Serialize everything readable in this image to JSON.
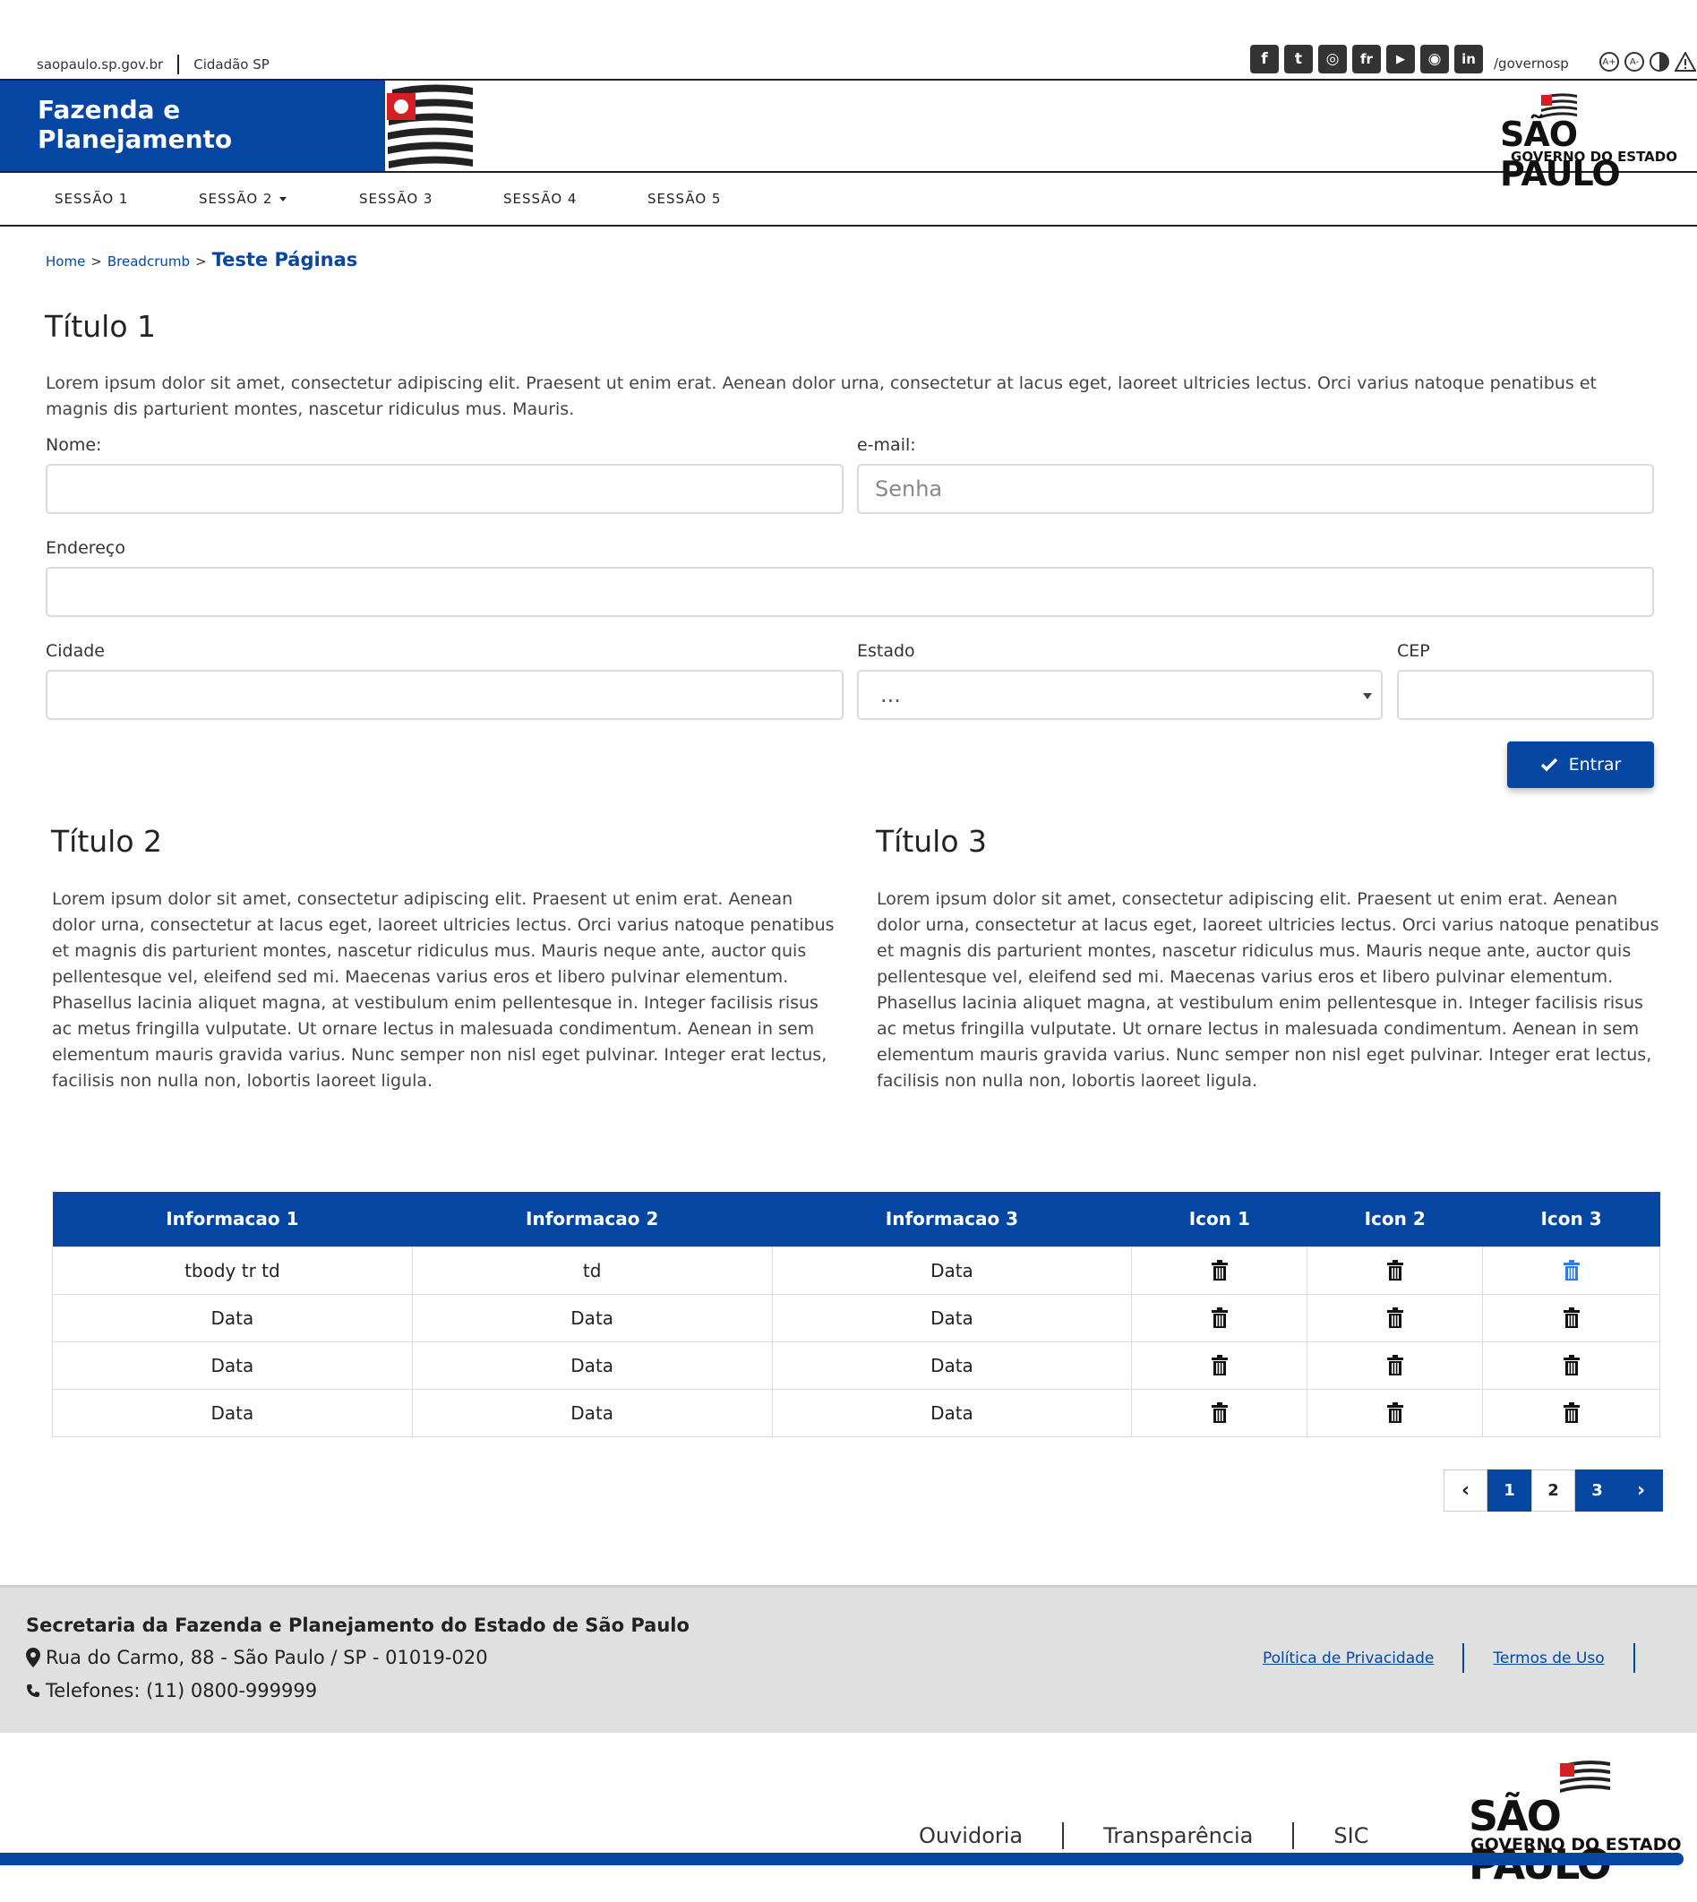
{
  "top": {
    "site_link": "saopaulo.sp.gov.br",
    "cidadao_link": "Cidadão SP",
    "social": [
      {
        "icon": "facebook-icon",
        "glyph": "f"
      },
      {
        "icon": "twitter-icon",
        "glyph": "t"
      },
      {
        "icon": "instagram-icon",
        "glyph": "◎"
      },
      {
        "icon": "flickr-icon",
        "glyph": "fr"
      },
      {
        "icon": "youtube-icon",
        "glyph": "▶"
      },
      {
        "icon": "periscope-icon",
        "glyph": "◉"
      },
      {
        "icon": "linkedin-icon",
        "glyph": "in"
      }
    ],
    "handle": "/governosp"
  },
  "header": {
    "brand_line1": "Fazenda e",
    "brand_line2": "Planejamento",
    "logo_big": "SÃO PAULO",
    "logo_small": "GOVERNO DO ESTADO"
  },
  "nav": {
    "items": [
      "SESSÃO 1",
      "SESSÃO 2",
      "SESSÃO 3",
      "SESSÃO 4",
      "SESSÃO 5"
    ]
  },
  "breadcrumb": {
    "home": "Home",
    "mid": "Breadcrumb",
    "current": "Teste Páginas"
  },
  "section1": {
    "title": "Título 1",
    "text": "Lorem ipsum dolor sit amet, consectetur adipiscing elit. Praesent ut enim erat. Aenean dolor urna, consectetur at lacus eget, laoreet ultricies lectus. Orci varius natoque penatibus et magnis dis parturient montes, nascetur ridiculus mus. Mauris."
  },
  "form": {
    "nome_label": "Nome:",
    "nome_value": "",
    "email_label": "e-mail:",
    "email_placeholder": "Senha",
    "endereco_label": "Endereço",
    "cidade_label": "Cidade",
    "estado_label": "Estado",
    "estado_selected": "...",
    "cep_label": "CEP",
    "submit_label": "Entrar"
  },
  "section2": {
    "title": "Título 2",
    "text": "Lorem ipsum dolor sit amet, consectetur adipiscing elit. Praesent ut enim erat. Aenean dolor urna, consectetur at lacus eget, laoreet ultricies lectus. Orci varius natoque penatibus et magnis dis parturient montes, nascetur ridiculus mus. Mauris neque ante, auctor quis pellentesque vel, eleifend sed mi. Maecenas varius eros et libero pulvinar elementum. Phasellus lacinia aliquet magna, at vestibulum enim pellentesque in. Integer facilisis risus ac metus fringilla vulputate. Ut ornare lectus in malesuada condimentum. Aenean in sem elementum mauris gravida varius. Nunc semper non nisl eget pulvinar. Integer erat lectus, facilisis non nulla non, lobortis laoreet ligula."
  },
  "section3": {
    "title": "Título 3",
    "text": "Lorem ipsum dolor sit amet, consectetur adipiscing elit. Praesent ut enim erat. Aenean dolor urna, consectetur at lacus eget, laoreet ultricies lectus. Orci varius natoque penatibus et magnis dis parturient montes, nascetur ridiculus mus. Mauris neque ante, auctor quis pellentesque vel, eleifend sed mi. Maecenas varius eros et libero pulvinar elementum. Phasellus lacinia aliquet magna, at vestibulum enim pellentesque in. Integer facilisis risus ac metus fringilla vulputate. Ut ornare lectus in malesuada condimentum. Aenean in sem elementum mauris gravida varius. Nunc semper non nisl eget pulvinar. Integer erat lectus, facilisis non nulla non, lobortis laoreet ligula."
  },
  "table": {
    "headers": [
      "Informacao 1",
      "Informacao 2",
      "Informacao 3",
      "Icon 1",
      "Icon 2",
      "Icon 3"
    ],
    "rows": [
      [
        "tbody tr td",
        "td",
        "Data"
      ],
      [
        "Data",
        "Data",
        "Data"
      ],
      [
        "Data",
        "Data",
        "Data"
      ],
      [
        "Data",
        "Data",
        "Data"
      ]
    ],
    "icon": "trash-icon",
    "highlight_color": "#2f7de1"
  },
  "pagination": {
    "prev": "‹",
    "pages": [
      "1",
      "2",
      "3"
    ],
    "next": "›",
    "current": "2"
  },
  "footer": {
    "org": "Secretaria da Fazenda e Planejamento do Estado de São Paulo",
    "address": "Rua do Carmo, 88 - São Paulo / SP - 01019-020",
    "phone": "Telefones: (11) 0800-999999",
    "privacy": "Política de Privacidade",
    "terms": "Termos de Uso"
  },
  "bottom": {
    "links": [
      "Ouvidoria",
      "Transparência",
      "SIC"
    ],
    "logo_big": "SÃO PAULO",
    "logo_small": "GOVERNO DO ESTADO"
  },
  "colors": {
    "brand_blue": "#0446a1",
    "footer_gray": "#e0e0e0"
  }
}
